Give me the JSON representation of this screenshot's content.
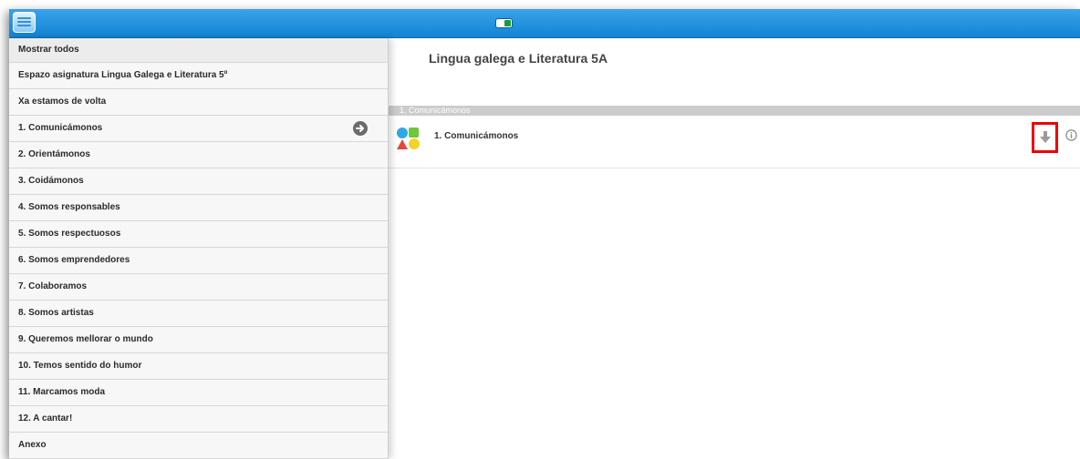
{
  "sidebar": {
    "items": [
      {
        "label": "Mostrar todos"
      },
      {
        "label": "Espazo asignatura Lingua Galega e Literatura 5º"
      },
      {
        "label": "Xa estamos de volta"
      },
      {
        "label": "1. Comunicámonos"
      },
      {
        "label": "2. Orientámonos"
      },
      {
        "label": "3. Coidámonos"
      },
      {
        "label": "4. Somos responsables"
      },
      {
        "label": "5. Somos respectuosos"
      },
      {
        "label": "6. Somos emprendedores"
      },
      {
        "label": "7. Colaboramos"
      },
      {
        "label": "8. Somos artistas"
      },
      {
        "label": "9. Queremos mellorar o mundo"
      },
      {
        "label": "10. Temos sentido do humor"
      },
      {
        "label": "11. Marcamos moda"
      },
      {
        "label": "12. A cantar!"
      },
      {
        "label": "Anexo"
      }
    ]
  },
  "content": {
    "title": "Lingua galega e Literatura 5A",
    "section_header": "1. Comunicámonos",
    "resource": {
      "label": "1. Comunicámonos"
    }
  },
  "colors": {
    "topbar": "#1a8ddb",
    "highlight": "#ee0000"
  },
  "icons": {
    "menu": "menu-icon",
    "toggle": "toggle-icon",
    "arrow": "arrow-right-circle-icon",
    "resource": "shapes-icon",
    "download": "download-icon",
    "info": "info-icon"
  }
}
